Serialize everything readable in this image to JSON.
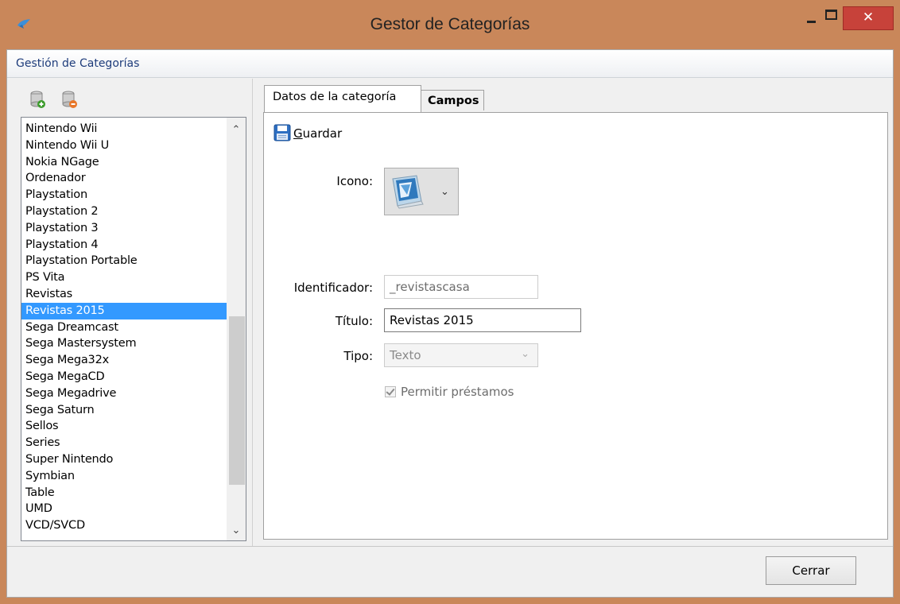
{
  "window": {
    "title": "Gestor de Categorías",
    "close_glyph": "✕",
    "accent_color": "#c9875a",
    "close_color": "#c7423a"
  },
  "group_header": {
    "title": "Gestión de Categorías"
  },
  "toolbar": {
    "add_icon": "database-add-icon",
    "remove_icon": "database-remove-icon"
  },
  "category_list": {
    "items": [
      "Nintendo Wii",
      "Nintendo Wii U",
      "Nokia NGage",
      "Ordenador",
      "Playstation",
      "Playstation 2",
      "Playstation 3",
      "Playstation 4",
      "Playstation Portable",
      "PS Vita",
      "Revistas",
      "Revistas 2015",
      "Sega Dreamcast",
      "Sega Mastersystem",
      "Sega Mega32x",
      "Sega MegaCD",
      "Sega Megadrive",
      "Sega Saturn",
      "Sellos",
      "Series",
      "Super Nintendo",
      "Symbian",
      "Table",
      "UMD",
      "VCD/SVCD"
    ],
    "selected": "Revistas 2015",
    "selection_color": "#3399ff"
  },
  "tabs": {
    "active": "Datos de la categoría",
    "inactive": "Campos"
  },
  "form": {
    "save_label_prefix": "G",
    "save_label_rest": "uardar",
    "icon_label": "Icono:",
    "identifier_label": "Identificador:",
    "identifier_value": "_revistascasa",
    "title_label": "Título:",
    "title_value": "Revistas 2015",
    "type_label": "Tipo:",
    "type_value": "Texto",
    "allow_loans_label": "Permitir préstamos",
    "allow_loans_checked": true
  },
  "footer": {
    "close_label": "Cerrar"
  }
}
